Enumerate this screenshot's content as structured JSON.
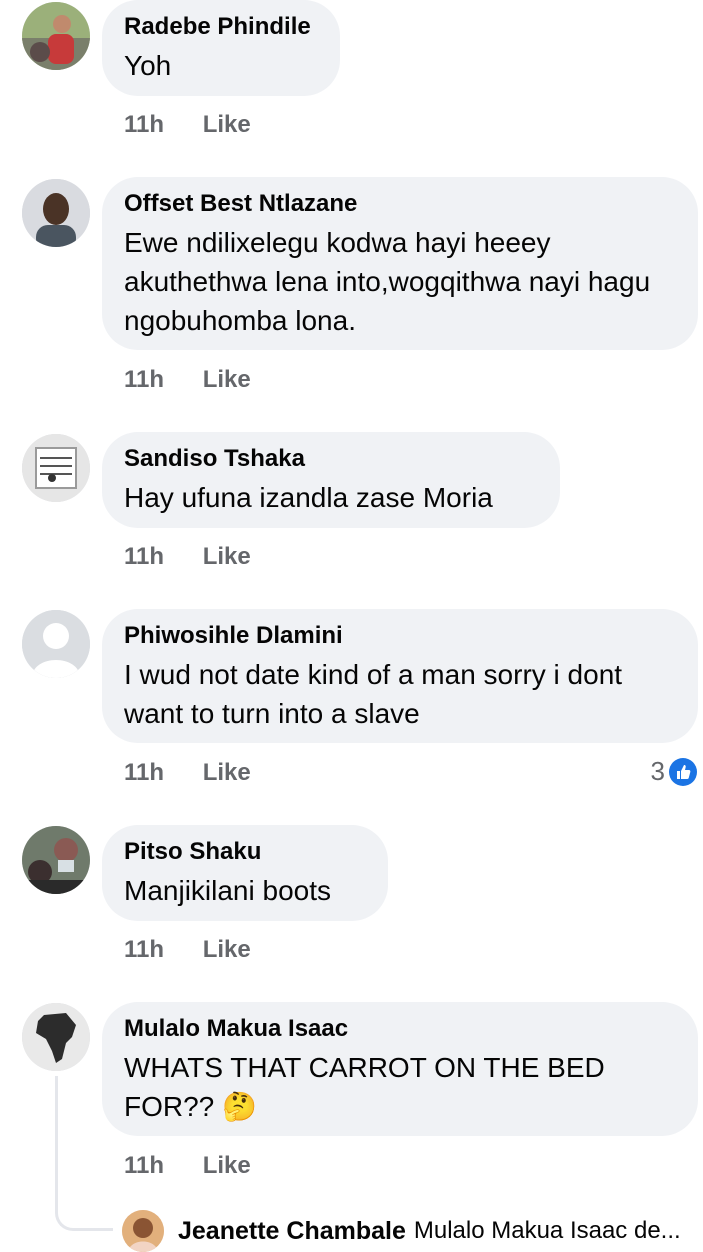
{
  "comments": [
    {
      "author": "Radebe Phindile",
      "text": "Yoh",
      "time": "11h",
      "like": "Like"
    },
    {
      "author": "Offset Best Ntlazane",
      "text": "Ewe ndilixelegu kodwa hayi heeey akuthethwa lena into,wogqithwa nayi hagu ngobuhomba lona.",
      "time": "11h",
      "like": "Like"
    },
    {
      "author": "Sandiso Tshaka",
      "text": "Hay ufuna izandla zase Moria",
      "time": "11h",
      "like": "Like"
    },
    {
      "author": "Phiwosihle Dlamini",
      "text": "I wud not date kind of a man sorry i dont want to turn into a slave",
      "time": "11h",
      "like": "Like",
      "reactions": "3"
    },
    {
      "author": "Pitso Shaku",
      "text": "Manjikilani boots",
      "time": "11h",
      "like": "Like"
    },
    {
      "author": "Mulalo Makua Isaac",
      "text": "WHATS THAT CARROT ON THE BED FOR??",
      "emoji": "🤔",
      "time": "11h",
      "like": "Like"
    }
  ],
  "reply": {
    "author": "Jeanette Chambale",
    "text": "Mulalo Makua Isaac de..."
  },
  "colors": {
    "bubble": "#f0f2f5",
    "meta": "#65676b",
    "like_blue": "#1b74e4"
  }
}
